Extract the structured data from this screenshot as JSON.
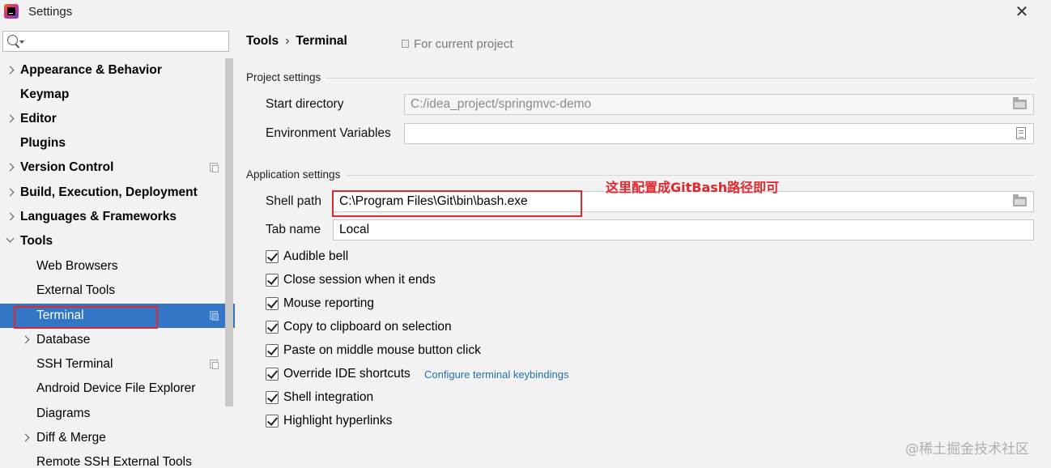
{
  "window": {
    "title": "Settings"
  },
  "sidebar": {
    "search_placeholder": "",
    "items": [
      {
        "label": "Appearance & Behavior",
        "bold": true
      },
      {
        "label": "Keymap",
        "bold": true
      },
      {
        "label": "Editor",
        "bold": true
      },
      {
        "label": "Plugins",
        "bold": true
      },
      {
        "label": "Version Control",
        "bold": true
      },
      {
        "label": "Build, Execution, Deployment",
        "bold": true
      },
      {
        "label": "Languages & Frameworks",
        "bold": true
      },
      {
        "label": "Tools",
        "bold": true
      },
      {
        "label": "Web Browsers"
      },
      {
        "label": "External Tools"
      },
      {
        "label": "Terminal",
        "selected": true
      },
      {
        "label": "Database"
      },
      {
        "label": "SSH Terminal"
      },
      {
        "label": "Android Device File Explorer"
      },
      {
        "label": "Diagrams"
      },
      {
        "label": "Diff & Merge"
      },
      {
        "label": "Remote SSH External Tools"
      }
    ]
  },
  "header": {
    "breadcrumb_root": "Tools",
    "breadcrumb_sep": "›",
    "breadcrumb_current": "Terminal",
    "scope_note": "For current project"
  },
  "project_settings": {
    "title": "Project settings",
    "start_directory_label": "Start directory",
    "start_directory_value": "C:/idea_project/springmvc-demo",
    "env_vars_label": "Environment Variables",
    "env_vars_value": ""
  },
  "application_settings": {
    "title": "Application settings",
    "shell_path_label": "Shell path",
    "shell_path_value": "C:\\Program Files\\Git\\bin\\bash.exe",
    "tab_name_label": "Tab name",
    "tab_name_value": "Local",
    "annotation": "这里配置成GitBash路径即可",
    "options": [
      {
        "label": "Audible bell",
        "checked": true
      },
      {
        "label": "Close session when it ends",
        "checked": true
      },
      {
        "label": "Mouse reporting",
        "checked": true
      },
      {
        "label": "Copy to clipboard on selection",
        "checked": true
      },
      {
        "label": "Paste on middle mouse button click",
        "checked": true
      },
      {
        "label": "Override IDE shortcuts",
        "checked": true,
        "link": "Configure terminal keybindings"
      },
      {
        "label": "Shell integration",
        "checked": true
      },
      {
        "label": "Highlight hyperlinks",
        "checked": true
      }
    ]
  },
  "watermark": "@稀土掘金技术社区",
  "colors": {
    "selection": "#3276c5",
    "highlight_red": "#e0282e",
    "link": "#2470b3"
  }
}
